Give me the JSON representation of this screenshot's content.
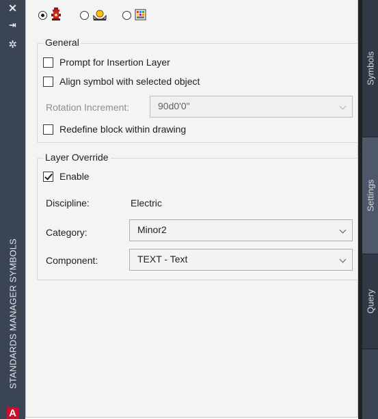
{
  "palette": {
    "panel_background": "#f4f4f4",
    "strip_background": "#3b4453",
    "logo_red": "#c8102e"
  },
  "palette_strip": {
    "title": "STANDARDS MANAGER SYMBOLS",
    "buttons": [
      {
        "name": "close-icon",
        "glyph": "×"
      },
      {
        "name": "autohide-icon",
        "glyph": "⇥"
      },
      {
        "name": "properties-icon",
        "glyph": "✲"
      }
    ],
    "logo_letter": "A"
  },
  "side_tabs": [
    "Symbols",
    "Settings",
    "Query"
  ],
  "symbol_types": [
    {
      "icon": "hydrant-icon",
      "checked": true
    },
    {
      "icon": "fixture-icon",
      "checked": false
    },
    {
      "icon": "panel-grid-icon",
      "checked": false
    }
  ],
  "general": {
    "title": "General",
    "prompt_insertion_layer": {
      "label": "Prompt for Insertion Layer",
      "checked": false
    },
    "align_symbol": {
      "label": "Align symbol with selected object",
      "checked": false
    },
    "rotation_increment": {
      "label": "Rotation Increment:",
      "value": "90d0'0\""
    },
    "redefine_block": {
      "label": "Redefine block within drawing",
      "checked": false
    }
  },
  "layer_override": {
    "title": "Layer Override",
    "enable": {
      "label": "Enable",
      "checked": true
    },
    "discipline": {
      "label": "Discipline:",
      "value": "Electric"
    },
    "category": {
      "label": "Category:",
      "value": "Minor2"
    },
    "component": {
      "label": "Component:",
      "value": "TEXT - Text"
    }
  }
}
